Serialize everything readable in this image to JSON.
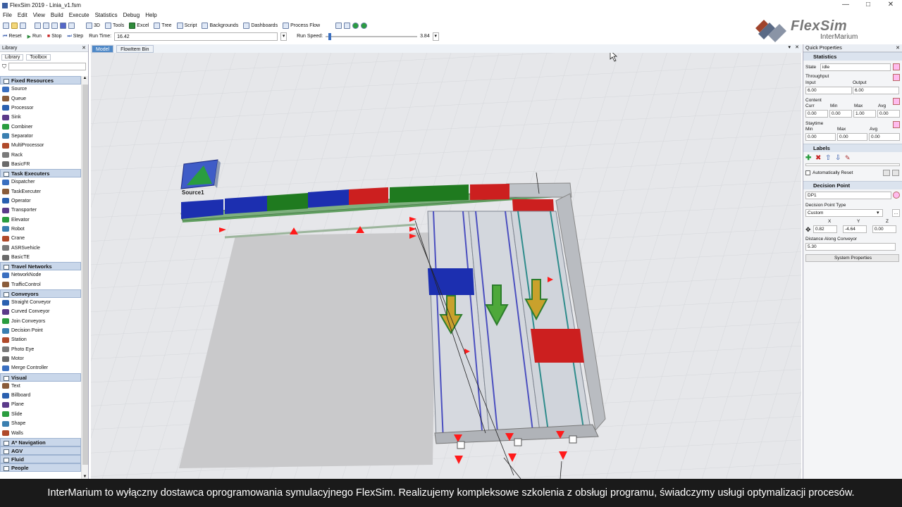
{
  "window": {
    "title": "FlexSim 2019 - Linia_v1.fsm",
    "minimize": "—",
    "maximize": "□",
    "close": "✕"
  },
  "menu": [
    "File",
    "Edit",
    "View",
    "Build",
    "Execute",
    "Statistics",
    "Debug",
    "Help"
  ],
  "toolbar": {
    "btn_3d": "3D",
    "btn_tools": "Tools",
    "btn_excel": "Excel",
    "btn_tree": "Tree",
    "btn_script": "Script",
    "btn_backgrounds": "Backgrounds",
    "btn_dashboards": "Dashboards",
    "btn_processflow": "Process Flow"
  },
  "runbar": {
    "reset": "Reset",
    "run": "Run",
    "stop": "Stop",
    "step": "Step",
    "run_time_label": "Run Time:",
    "run_time_value": "16.42",
    "run_speed_label": "Run Speed:",
    "run_speed_value": "3.84"
  },
  "logo": {
    "name": "FlexSim",
    "sub": "InterMarium"
  },
  "library": {
    "title": "Library",
    "tabs": [
      "Library",
      "Toolbox"
    ],
    "categories": [
      {
        "name": "Fixed Resources",
        "items": [
          "Source",
          "Queue",
          "Processor",
          "Sink",
          "Combiner",
          "Separator",
          "MultiProcessor",
          "Rack",
          "BasicFR"
        ]
      },
      {
        "name": "Task Executers",
        "items": [
          "Dispatcher",
          "TaskExecuter",
          "Operator",
          "Transporter",
          "Elevator",
          "Robot",
          "Crane",
          "ASRSvehicle",
          "BasicTE"
        ]
      },
      {
        "name": "Travel Networks",
        "items": [
          "NetworkNode",
          "TrafficControl"
        ]
      },
      {
        "name": "Conveyors",
        "items": [
          "Straight Conveyor",
          "Curved Conveyor",
          "Join Conveyors",
          "Decision Point",
          "Station",
          "Photo Eye",
          "Motor",
          "Merge Controller"
        ]
      },
      {
        "name": "Visual",
        "items": [
          "Text",
          "Billboard",
          "Plane",
          "Slide",
          "Shape",
          "Walls"
        ]
      },
      {
        "name": "A* Navigation",
        "items": []
      },
      {
        "name": "AGV",
        "items": []
      },
      {
        "name": "Fluid",
        "items": []
      },
      {
        "name": "People",
        "items": []
      }
    ]
  },
  "view_tabs": [
    "Model",
    "FlowItem Bin"
  ],
  "model": {
    "source_label": "Source1"
  },
  "quick_properties": {
    "title": "Quick Properties",
    "statistics": {
      "header": "Statistics",
      "state_label": "State",
      "state_value": "idle",
      "throughput_label": "Throughput",
      "input_label": "Input",
      "input_value": "6.00",
      "output_label": "Output",
      "output_value": "6.00",
      "content_label": "Content",
      "curr_label": "Curr",
      "min_label": "Min",
      "max_label": "Max",
      "avg_label": "Avg",
      "content_values": [
        "0.00",
        "0.00",
        "1.00",
        "0.00"
      ],
      "staytime_label": "Staytime",
      "staytime_values": [
        "0.00",
        "0.00",
        "0.00"
      ]
    },
    "labels": {
      "header": "Labels",
      "auto_reset": "Automatically Reset"
    },
    "decision_point": {
      "header": "Decision Point",
      "name": "DP1",
      "type_label": "Decision Point Type",
      "type_value": "Custom",
      "x_label": "X",
      "y_label": "Y",
      "z_label": "Z",
      "x": "0.82",
      "y": "-4.64",
      "z": "0.00",
      "distance_label": "Distance Along Conveyor",
      "distance_value": "5.30",
      "system_properties": "System Properties"
    }
  },
  "subtitle": "InterMarium to wyłączny dostawca oprogramowania symulacyjnego FlexSim. Realizujemy kompleksowe szkolenia z obsługi programu, świadczymy usługi optymalizacji procesów.",
  "colors": {
    "accent": "#4e88c7",
    "blue_box": "#1c2fb0",
    "green_box": "#1f7a1f",
    "red_box": "#cc1f1f",
    "subtitle_bg": "#1a1a1a"
  }
}
